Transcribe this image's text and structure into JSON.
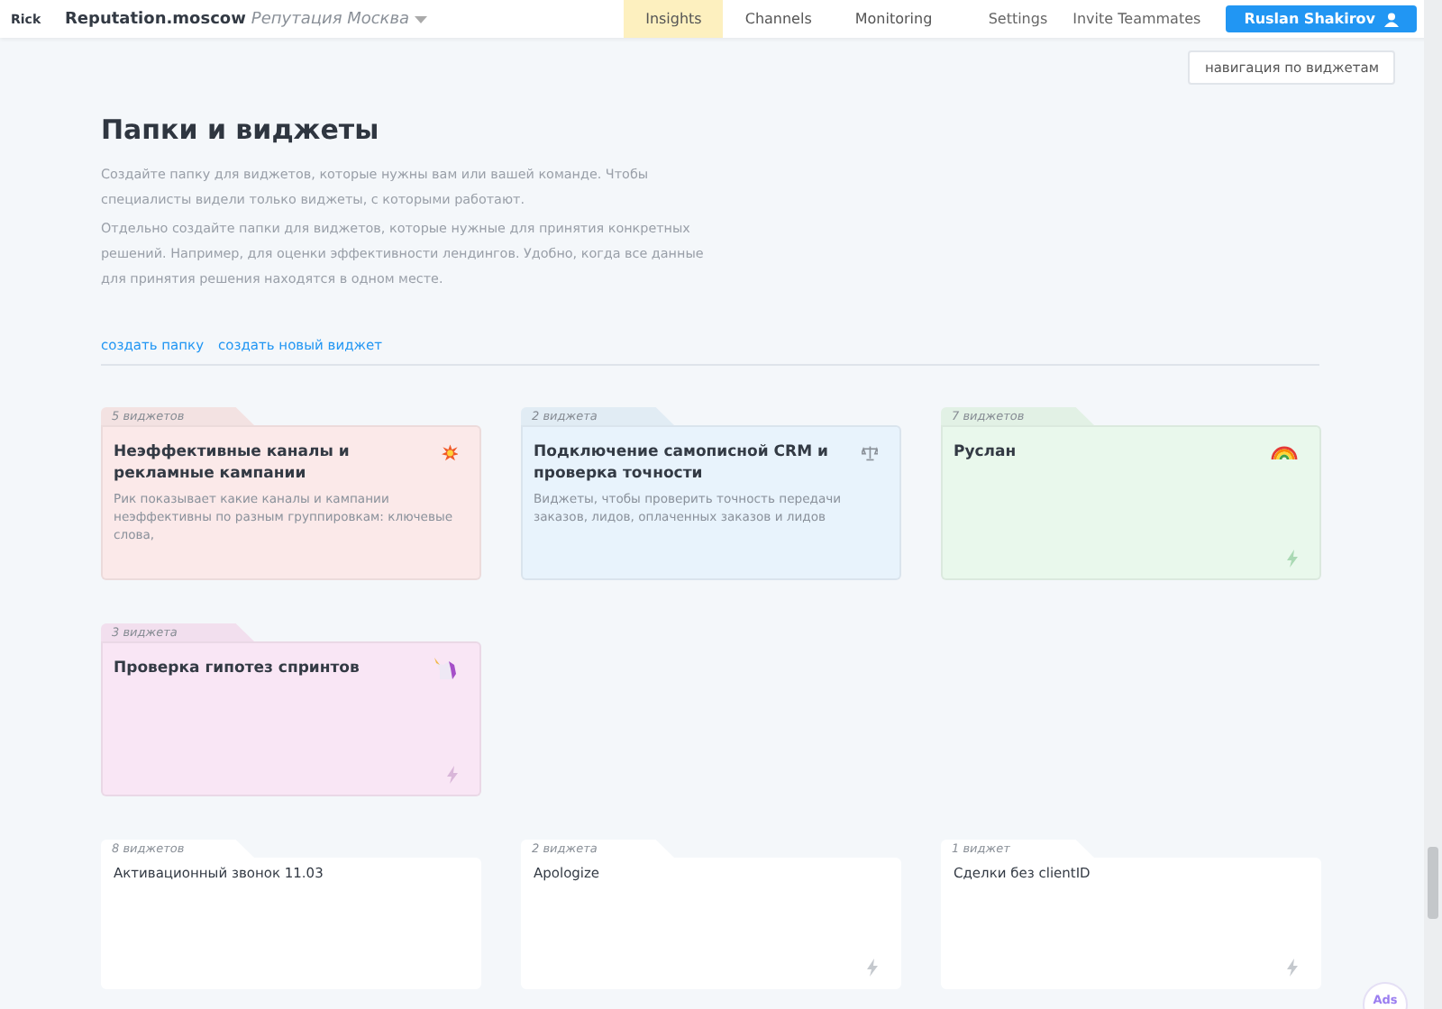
{
  "header": {
    "logo": "Rick",
    "brand": "Reputation.moscow",
    "project": "Репутация Москва",
    "tabs": [
      {
        "label": "Insights",
        "selected": true
      },
      {
        "label": "Channels",
        "selected": false
      },
      {
        "label": "Monitoring",
        "selected": false
      }
    ],
    "links": [
      "Settings",
      "Invite Teammates"
    ],
    "user": "Ruslan Shakirov"
  },
  "nav_button": "навигация по виджетам",
  "title": "Папки и виджеты",
  "paragraphs": [
    "Создайте папку для виджетов, которые нужны вам или вашей команде. Чтобы специалисты видели только виджеты, с которыми работают.",
    "Отдельно создайте папки для виджетов, которые нужные для принятия конкретных решений. Например, для оценки эффективности лендингов. Удобно, когда все данные для принятия решения находятся в одном месте."
  ],
  "actions": [
    "создать папку",
    "создать новый виджет"
  ],
  "folders": [
    {
      "kind": "colored",
      "color": "#fbe9e9",
      "count": "5 виджетов",
      "name": "Неэффективные каналы и рекламные кампании",
      "description": "Рик показывает какие каналы и кампании неэффективны по разным группировкам: ключевые слова,",
      "bolt": false
    },
    {
      "kind": "colored",
      "color": "#e8f3fc",
      "count": "2 виджета",
      "name": "Подключение самописной CRM и проверка точности",
      "description": "Виджеты, чтобы проверить точность передачи заказов, лидов, оплаченных заказов и лидов",
      "bolt": false
    },
    {
      "kind": "colored",
      "color": "#e9f8ec",
      "count": "7 виджетов",
      "name": "Руслан",
      "bolt": true
    },
    {
      "kind": "colored",
      "color": "#f9e6f5",
      "count": "3 виджета",
      "name": "Проверка гипотез спринтов",
      "bolt": true
    },
    {
      "kind": "plain",
      "count": "8 виджетов",
      "name": "Активационный звонок 11.03",
      "bolt": false
    },
    {
      "kind": "plain",
      "count": "2 виджета",
      "name": "Apologize",
      "bolt": true
    },
    {
      "kind": "plain",
      "count": "1 виджет",
      "name": "Сделки без clientID",
      "bolt": true
    }
  ],
  "ads_button": "Ads"
}
